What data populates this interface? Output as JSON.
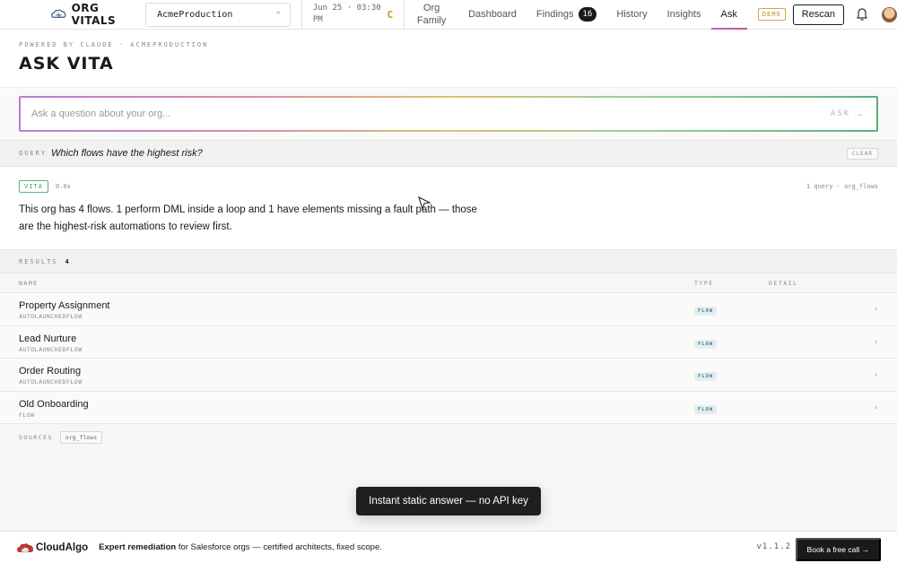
{
  "nav": {
    "brand": "ORG VITALS",
    "org_select": "AcmeProduction",
    "scan_date": "Jun 25 · 03:30 PM",
    "grade": "C",
    "tabs": [
      {
        "label": "Org Family"
      },
      {
        "label": "Dashboard"
      },
      {
        "label": "Findings",
        "badge": "16"
      },
      {
        "label": "History"
      },
      {
        "label": "Insights"
      },
      {
        "label": "Ask"
      }
    ],
    "demo_badge": "DEMO",
    "rescan": "Rescan"
  },
  "header": {
    "powered": "POWERED BY CLAUDE · ACMEPRODUCTION",
    "title": "ASK VITA"
  },
  "search": {
    "placeholder": "Ask a question about your org...",
    "value": "",
    "ask_label": "ASK",
    "enter_glyph": "↵"
  },
  "query": {
    "label": "QUERY",
    "text": "Which flows have the highest risk?",
    "clear": "CLEAR"
  },
  "answer": {
    "tag": "VITA",
    "elapsed": "0.0s",
    "meta": "1 query · org_flows",
    "text": "This org has 4 flows. 1 perform DML inside a loop and 1 have elements missing a fault path — those are the highest-risk automations to review first."
  },
  "results": {
    "label": "RESULTS",
    "count": "4",
    "columns": {
      "name": "NAME",
      "type": "TYPE",
      "detail": "DETAIL"
    },
    "rows": [
      {
        "name": "Property Assignment",
        "sub": "AUTOLAUNCHEDFLOW",
        "type": "FLOW"
      },
      {
        "name": "Lead Nurture",
        "sub": "AUTOLAUNCHEDFLOW",
        "type": "FLOW"
      },
      {
        "name": "Order Routing",
        "sub": "AUTOLAUNCHEDFLOW",
        "type": "FLOW"
      },
      {
        "name": "Old Onboarding",
        "sub": "FLOW",
        "type": "FLOW"
      }
    ],
    "sources_label": "SOURCES",
    "source_chip": "org_flows"
  },
  "toast": "Instant static answer — no API key",
  "footer": {
    "company": "CloudAlgo",
    "lead": "Expert remediation",
    "rest": " for Salesforce orgs — certified architects, fixed scope.",
    "version": "v1.1.2",
    "cta": "Book a free call →"
  },
  "colors": {
    "accent_gradient": [
      "#b87bd8",
      "#d98aa8",
      "#e0c070",
      "#8fcf9f",
      "#5fae7f"
    ],
    "grade": "#c9960e",
    "vita_tag": "#5fae7f"
  }
}
